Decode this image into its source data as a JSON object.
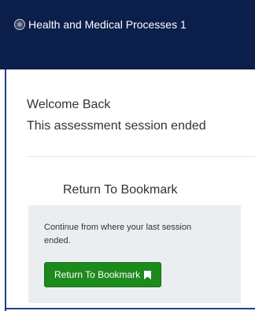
{
  "header": {
    "title": "Health and Medical Processes 1"
  },
  "main": {
    "welcome": "Welcome Back",
    "ended_message": "This assessment session ended"
  },
  "bookmark": {
    "heading": "Return To Bookmark",
    "description": "Continue from where your last session ended.",
    "button_label": "Return To Bookmark",
    "button_icon": "bookmark-icon"
  },
  "colors": {
    "header_bg": "#0b1f4a",
    "button_bg": "#1c8a1c",
    "card_bg": "#ebeef0"
  }
}
